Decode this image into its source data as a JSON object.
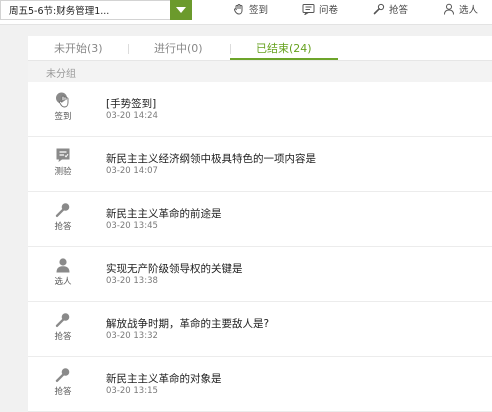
{
  "course_select": {
    "label": "周五5-6节:财务管理1..."
  },
  "toolbar": [
    {
      "name": "签到",
      "icon": "hand-icon"
    },
    {
      "name": "问卷",
      "icon": "survey-icon"
    },
    {
      "name": "抢答",
      "icon": "microphone-icon"
    },
    {
      "name": "选人",
      "icon": "person-icon"
    }
  ],
  "tabs": [
    {
      "label": "未开始(3)"
    },
    {
      "label": "进行中(0)"
    },
    {
      "label": "已结束(24)",
      "active": true
    }
  ],
  "group_label": "未分组",
  "items": [
    {
      "type": "签到",
      "icon": "hand-icon",
      "title": "[手势签到]",
      "time": "03-20 14:24"
    },
    {
      "type": "测验",
      "icon": "quiz-icon",
      "title": "新民主主义经济纲领中极具特色的一项内容是",
      "time": "03-20 14:07"
    },
    {
      "type": "抢答",
      "icon": "microphone-icon",
      "title": "新民主主义革命的前途是",
      "time": "03-20 13:45"
    },
    {
      "type": "选人",
      "icon": "person-icon",
      "title": "实现无产阶级领导权的关键是",
      "time": "03-20 13:38"
    },
    {
      "type": "抢答",
      "icon": "microphone-icon",
      "title": "解放战争时期，革命的主要敌人是?",
      "time": "03-20 13:32"
    },
    {
      "type": "抢答",
      "icon": "microphone-icon",
      "title": "新民主主义革命的对象是",
      "time": "03-20 13:15"
    }
  ],
  "colors": {
    "accent": "#66a11e",
    "icon_gray": "#8a8a8a"
  }
}
